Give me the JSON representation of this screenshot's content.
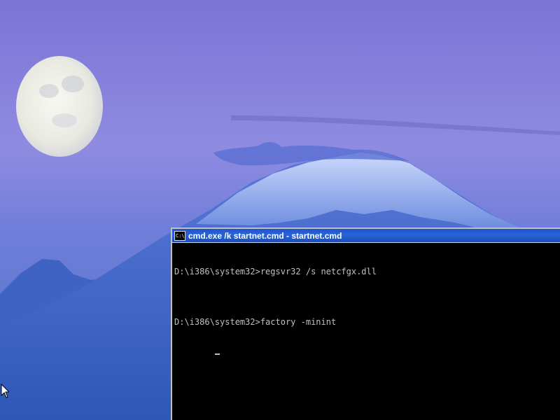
{
  "desktop": {
    "wallpaper": "mountain-and-moon-wallpaper",
    "cursor": "arrow-cursor"
  },
  "window": {
    "title": "cmd.exe /k startnet.cmd - startnet.cmd",
    "icon": "command-prompt-icon",
    "icon_text": "C:\\",
    "colors": {
      "titlebar": "#2a63d8",
      "background": "#000000",
      "text": "#c0c0c0"
    }
  },
  "console": {
    "lines": [
      "D:\\i386\\system32>regsvr32 /s netcfgx.dll",
      "",
      "D:\\i386\\system32>factory -minint"
    ],
    "cursor": "_"
  }
}
